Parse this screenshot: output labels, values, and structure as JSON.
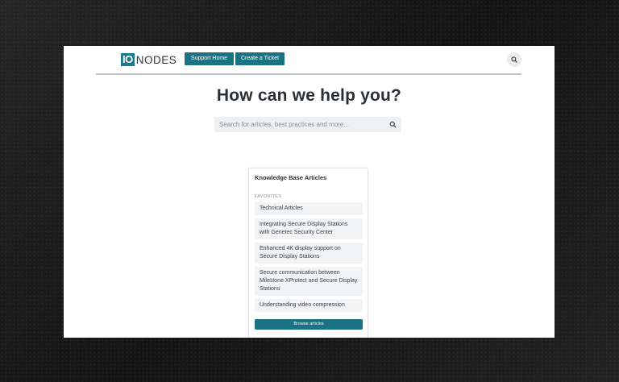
{
  "header": {
    "logo_mark": "IO",
    "logo_text": "NODES",
    "nav": [
      {
        "label": "Support Home"
      },
      {
        "label": "Create a Ticket"
      }
    ],
    "search_icon": "search-icon"
  },
  "hero": {
    "title": "How can we help you?",
    "search_placeholder": "Search for articles, best practices and more...",
    "search_icon": "search-icon"
  },
  "knowledge_base": {
    "title": "Knowledge Base Articles",
    "section_label": "FAVORITES",
    "items": [
      {
        "label": "Technical Articles"
      },
      {
        "label": "Integrating Secure Display Stations with Genetec Security Center"
      },
      {
        "label": "Enhanced 4K display support on Secure Display Stations"
      },
      {
        "label": "Secure communication between Milestone XProtect and Secure Display Stations"
      },
      {
        "label": "Understanding video compression"
      }
    ],
    "button_label": "Browse articles"
  },
  "colors": {
    "brand": "#1a7282",
    "logo": "#1d7a8c",
    "title_text": "#2b2f33",
    "item_bg": "#f2f3f5"
  }
}
